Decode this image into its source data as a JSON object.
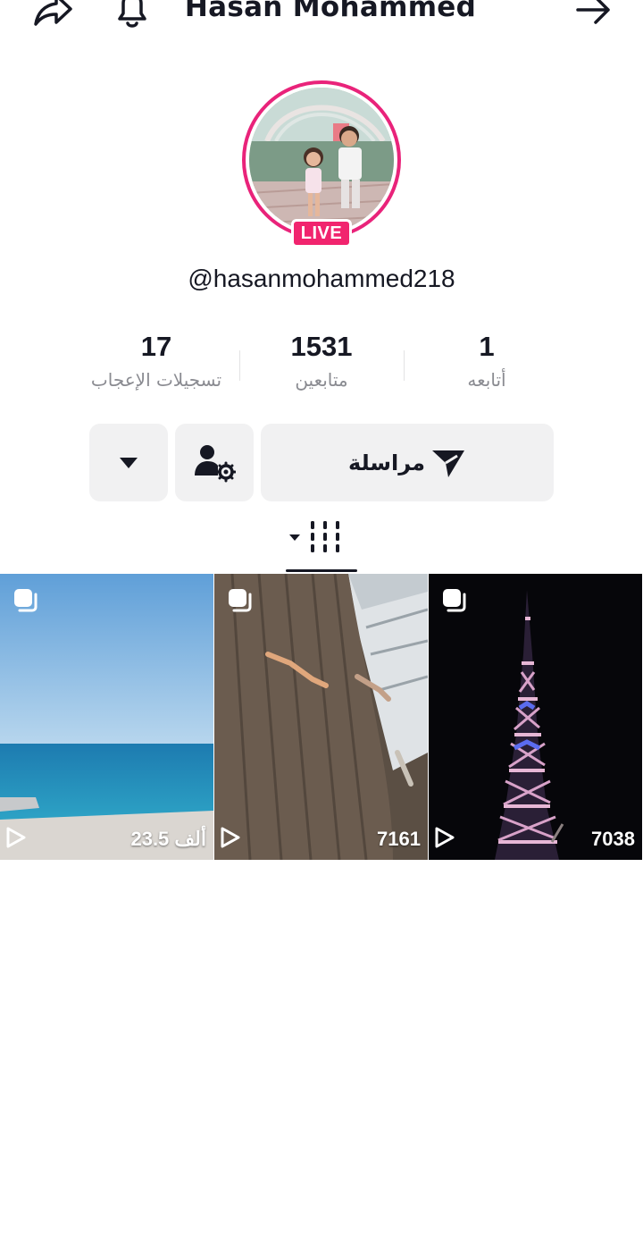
{
  "header": {
    "title": "Hasan Mohammed",
    "icons": [
      "share-icon",
      "bell-icon",
      "arrow-right-icon"
    ]
  },
  "profile": {
    "username": "@hasanmohammed218",
    "live_badge": "LIVE"
  },
  "stats": {
    "likes": {
      "value": "17",
      "label": "تسجيلات الإعجاب"
    },
    "followers": {
      "value": "1531",
      "label": "متابعين"
    },
    "following": {
      "value": "1",
      "label": "أتابعه"
    }
  },
  "actions": {
    "message_label": "مراسلة"
  },
  "videos": [
    {
      "views": "23.5 ألف",
      "scene": "sea"
    },
    {
      "views": "7161",
      "scene": "wall"
    },
    {
      "views": "7038",
      "scene": "tower"
    }
  ],
  "colors": {
    "accent": "#e9237a",
    "live": "#f1246e",
    "button_bg": "#f1f1f2",
    "text": "#161823",
    "muted": "#8a8b91"
  }
}
